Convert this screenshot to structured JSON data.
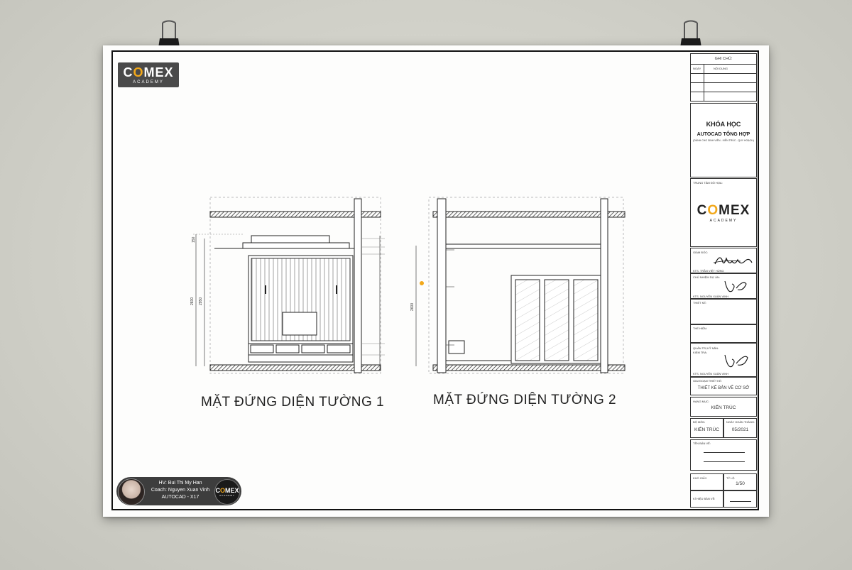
{
  "logo": {
    "main_prefix": "C",
    "main_o": "O",
    "main_suffix": "MEX",
    "sub": "ACADEMY"
  },
  "drawing1": {
    "caption": "MẶT ĐỨNG DIỆN TƯỜNG 1",
    "dims": [
      "150",
      "2830",
      "2950"
    ]
  },
  "drawing2": {
    "caption": "MẶT ĐỨNG DIỆN TƯỜNG 2",
    "dims": [
      "2600"
    ]
  },
  "student": {
    "line1": "HV: Bui Thi My Han",
    "line2": "Coach: Nguyen Xuan Vinh",
    "line3": "AUTOCAD - X17"
  },
  "title_block": {
    "notes_title": "GHI CHÚ:",
    "notes_col1": "NGÀY",
    "notes_col2": "NỘI DUNG",
    "course_line1": "KHÓA HỌC",
    "course_line2": "AUTOCAD TỔNG HỢP",
    "course_line3": "(DÀNH CHO SINH VIÊN - KIẾN TRÚC - QUY HOẠCH)",
    "center_label": "TRUNG TÂM ĐỒ HỌA:",
    "director_label": "GIÁM ĐỐC:",
    "director_name": "KTS. TRẦN VIỆT HÙNG",
    "project_lead_label": "CHỦ NHIỆM DỰ ÁN:",
    "project_lead_name": "KTS. NGUYỄN XUÂN VINH",
    "design_label": "THIẾT KẾ:",
    "drawn_label": "THỂ HIỆN:",
    "checker_label": "QUẢN TRỊ KỸ NĂN:",
    "checker_label2": "KIỂM TRA:",
    "checker_name": "KTS. NGUYỄN XUÂN VINH",
    "phase_label": "GIAI ĐOẠN THIẾT KẾ:",
    "phase_value": "THIẾT KẾ BẢN VẼ CƠ SỞ",
    "item_label": "HẠNG MỤC:",
    "item_value": "KIẾN TRÚC",
    "dept_label": "BỘ MÔN:",
    "dept_value": "KIẾN TRÚC",
    "date_label": "NGÀY HOÀN THÀNH:",
    "date_value": "05/2021",
    "sheet_title_label": "TÊN BẢN VẼ:",
    "paper_label": "KHỔ GIẤY:",
    "scale_label": "TỶ LỆ:",
    "scale_value": "1/50",
    "sheet_no_label": "KÍ HIỆU BẢN VẼ:"
  },
  "colors": {
    "accent": "#f2a81a",
    "background": "#d3d3cb",
    "ink": "#222222"
  },
  "icons": [
    "binder-clip-icon",
    "signature-icon"
  ]
}
